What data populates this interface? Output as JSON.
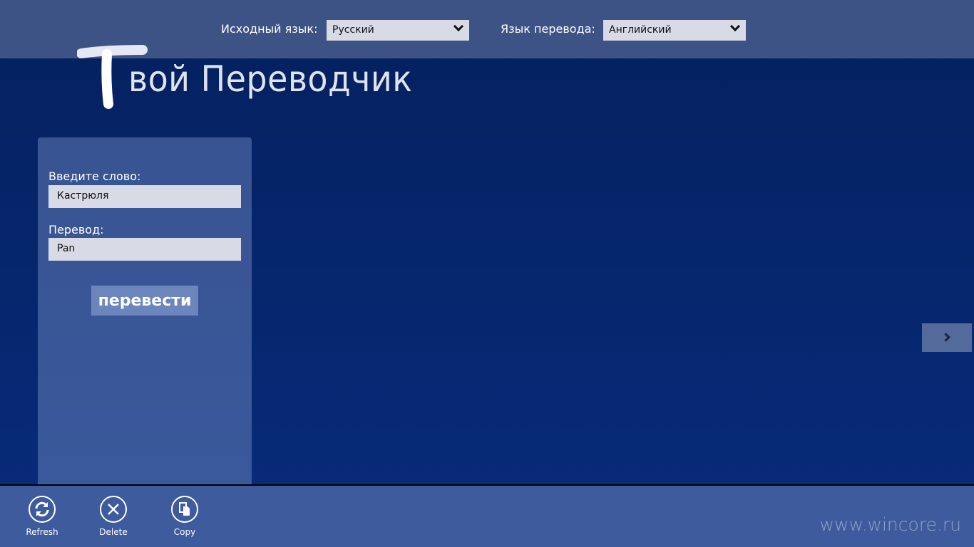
{
  "header": {
    "source_label": "Исходный язык:",
    "source_value": "Русский",
    "target_label": "Язык перевода:",
    "target_value": "Английский"
  },
  "app_title": {
    "logo_letter": "Т",
    "rest": "вой Переводчик"
  },
  "panel": {
    "word_label": "Введите слово:",
    "word_value": "Кастрюля",
    "translation_label": "Перевод:",
    "translation_value": "Pan",
    "translate_button": "перевести"
  },
  "next_icon": "chevron-right-icon",
  "appbar": {
    "buttons": [
      {
        "label": "Refresh",
        "icon": "refresh-icon"
      },
      {
        "label": "Delete",
        "icon": "close-icon"
      },
      {
        "label": "Copy",
        "icon": "copy-icon"
      }
    ]
  },
  "watermark": "www.wincore.ru",
  "colors": {
    "topbar": "#3d5385",
    "background": "#04205e",
    "appbar": "#3e5b9e"
  }
}
